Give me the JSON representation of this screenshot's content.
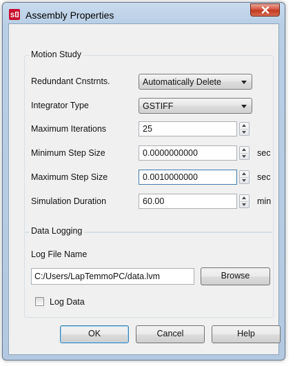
{
  "window": {
    "title": "Assembly Properties",
    "icon": "solidworks-app-icon",
    "close_icon": "close-icon"
  },
  "motion_study": {
    "group_title": "Motion Study",
    "redundant": {
      "label": "Redundant Cnstrnts.",
      "value": "Automatically Delete"
    },
    "integrator": {
      "label": "Integrator Type",
      "value": "GSTIFF"
    },
    "max_iterations": {
      "label": "Maximum Iterations",
      "value": "25"
    },
    "min_step": {
      "label": "Minimum Step Size",
      "value": "0.0000000000",
      "unit": "sec"
    },
    "max_step": {
      "label": "Maximum Step Size",
      "value": "0.0010000000",
      "unit": "sec"
    },
    "sim_duration": {
      "label": "Simulation Duration",
      "value": "60.00",
      "unit": "min"
    }
  },
  "data_logging": {
    "group_title": "Data Logging",
    "log_file_label": "Log File Name",
    "log_file_value": "C:/Users/LapTemmoPC/data.lvm",
    "browse_label": "Browse",
    "log_data_label": "Log Data",
    "log_data_checked": false
  },
  "buttons": {
    "ok": "OK",
    "cancel": "Cancel",
    "help": "Help"
  },
  "colors": {
    "frame": "#b9cfe6",
    "client": "#f0f0f0",
    "close": "#c23a22",
    "focus_border": "#3d7bad"
  }
}
